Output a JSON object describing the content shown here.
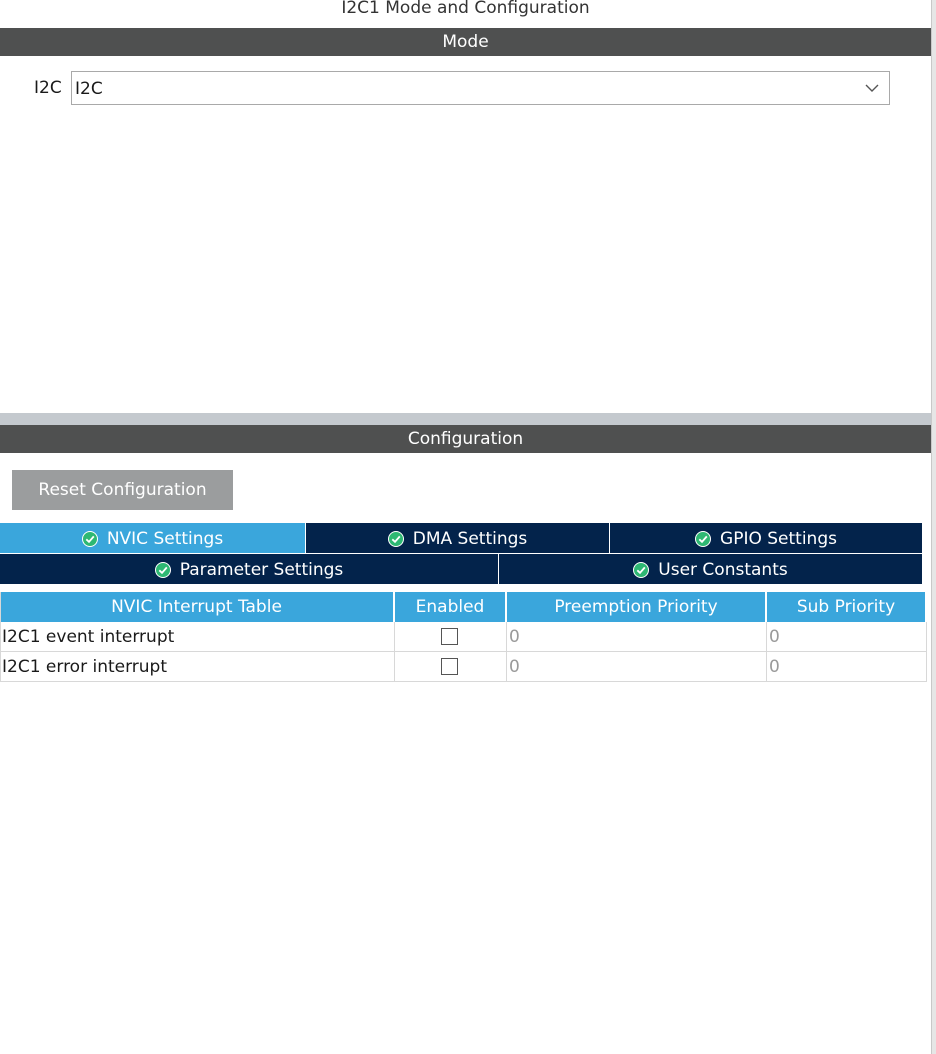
{
  "window": {
    "title": "I2C1 Mode and Configuration"
  },
  "mode": {
    "section_title": "Mode",
    "field_label": "I2C",
    "select_value": "I2C"
  },
  "configuration": {
    "section_title": "Configuration",
    "reset_label": "Reset Configuration",
    "tabs": [
      {
        "label": "NVIC Settings",
        "active": true
      },
      {
        "label": "DMA Settings",
        "active": false
      },
      {
        "label": "GPIO Settings",
        "active": false
      },
      {
        "label": "Parameter Settings",
        "active": false
      },
      {
        "label": "User Constants",
        "active": false
      }
    ]
  },
  "nvic_table": {
    "headers": [
      "NVIC Interrupt Table",
      "Enabled",
      "Preemption Priority",
      "Sub Priority"
    ],
    "rows": [
      {
        "name": "I2C1 event interrupt",
        "enabled": false,
        "preemption": "0",
        "sub": "0"
      },
      {
        "name": "I2C1 error interrupt",
        "enabled": false,
        "preemption": "0",
        "sub": "0"
      }
    ]
  },
  "colors": {
    "section_bar": "#4f5050",
    "tab_active": "#3aa6dc",
    "tab_inactive": "#03234b",
    "check_icon": "#2eb873",
    "reset_button": "#9b9d9e"
  },
  "icons": {
    "tab_status": "check-circle-icon",
    "select_arrow": "chevron-down-icon"
  }
}
